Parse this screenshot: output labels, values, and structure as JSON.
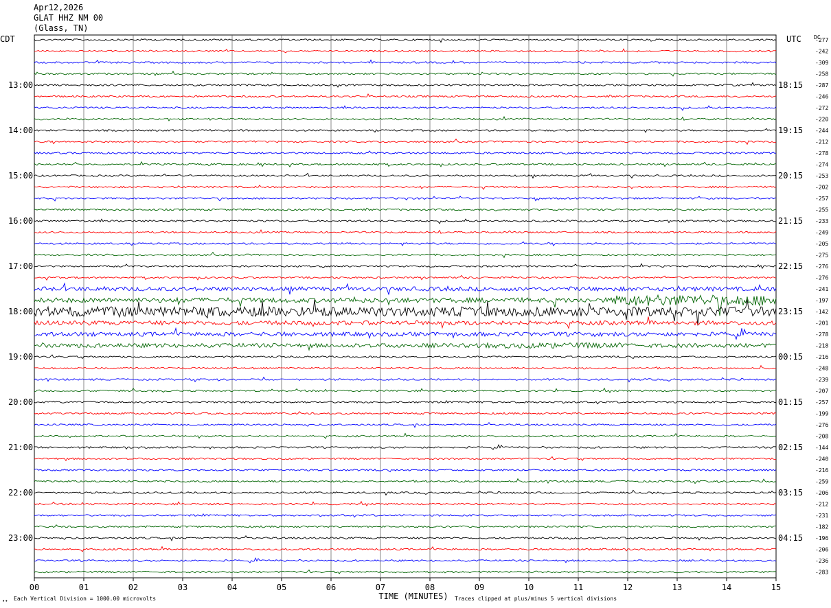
{
  "header": {
    "date": "Apr12,2026",
    "station": "GLAT HHZ NM 00",
    "location": "(Glass, TN)"
  },
  "chart_data": {
    "type": "line",
    "subtype": "helicorder",
    "xlabel": "TIME (MINUTES)",
    "x_ticks": [
      "00",
      "01",
      "02",
      "03",
      "04",
      "05",
      "06",
      "07",
      "08",
      "09",
      "10",
      "11",
      "12",
      "13",
      "14",
      "15"
    ],
    "xlim": [
      0,
      15
    ],
    "left_axis_title": "CDT",
    "right_axis_title": "UTC",
    "dc_title": "DC",
    "left_hour_labels": [
      "13:00",
      "14:00",
      "15:00",
      "16:00",
      "17:00",
      "18:00",
      "19:00",
      "20:00",
      "21:00",
      "22:00",
      "23:00"
    ],
    "right_hour_labels": [
      "18:15",
      "19:15",
      "20:15",
      "21:15",
      "22:15",
      "23:15",
      "00:15",
      "01:15",
      "02:15",
      "03:15",
      "04:15"
    ],
    "dc_offsets": [
      "-277",
      "-242",
      "-309",
      "-258",
      "-287",
      "-246",
      "-272",
      "-220",
      "-244",
      "-212",
      "-278",
      "-274",
      "-253",
      "-202",
      "-257",
      "-255",
      "-233",
      "-249",
      "-205",
      "-275",
      "-276",
      "-276",
      "-241",
      "-197",
      "-142",
      "-201",
      "-278",
      "-218",
      "-216",
      "-248",
      "-239",
      "-207",
      "-257",
      "-199",
      "-276",
      "-208",
      "-144",
      "-240",
      "-216",
      "-259",
      "-206",
      "-212",
      "-231",
      "-182",
      "-196",
      "-206",
      "-236",
      "-283"
    ],
    "trace_colors": [
      "#000000",
      "#ff0000",
      "#0000ff",
      "#006400"
    ],
    "grid": true,
    "footer_left": "Each Vertical Division = 1000.00 microvolts",
    "footer_right": "Traces clipped at plus/minus 5 vertical divisions",
    "footer_marker": "∙∙"
  }
}
